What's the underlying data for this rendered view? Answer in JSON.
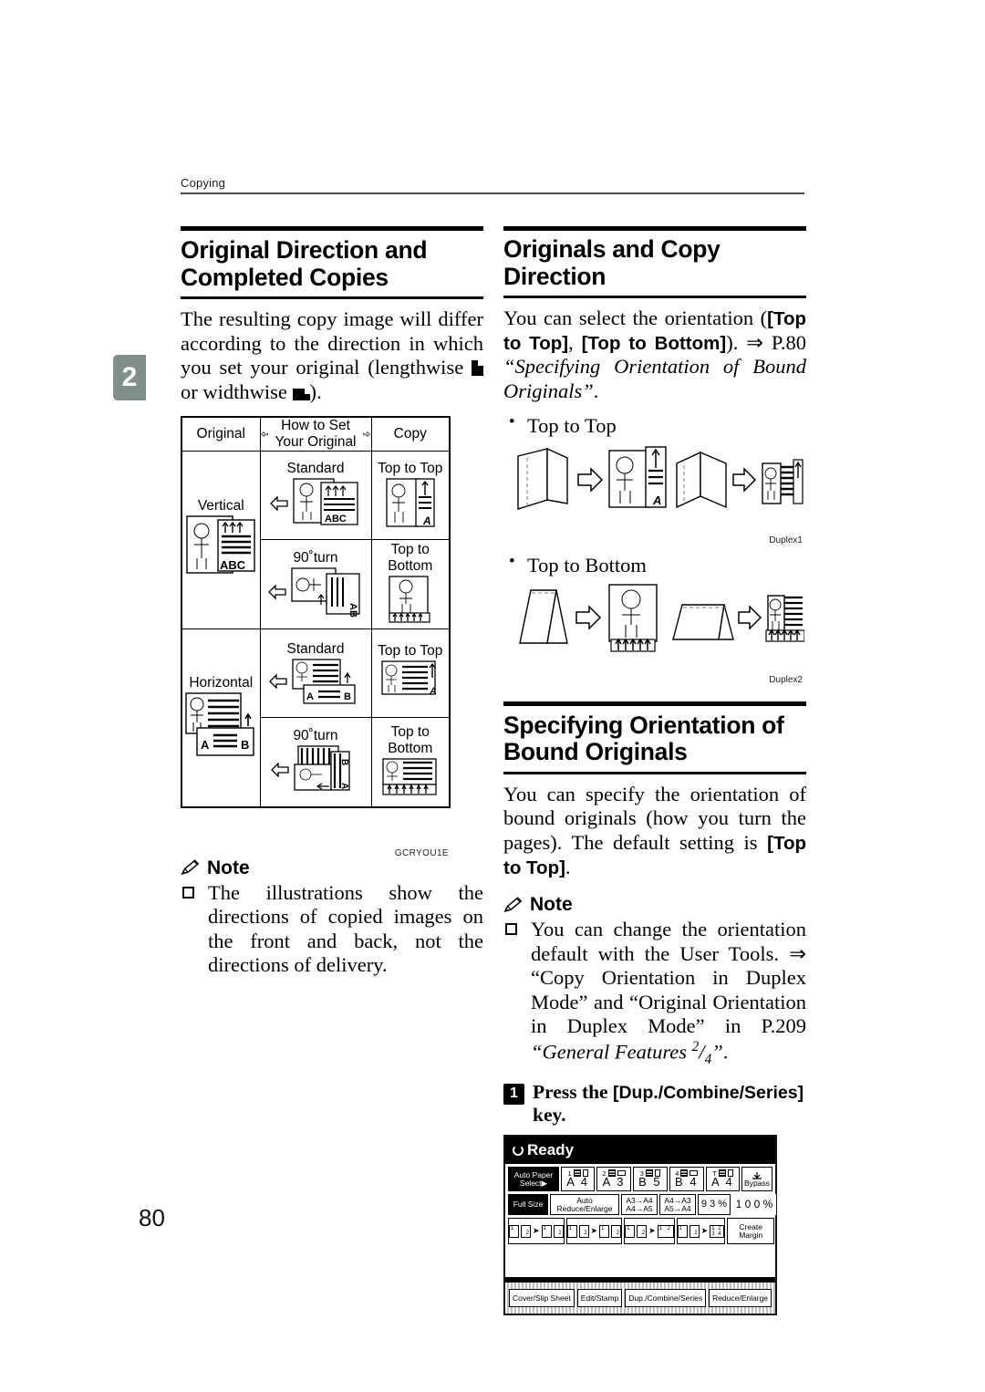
{
  "running_head": "Copying",
  "chapter_tab": "2",
  "folio": "80",
  "left": {
    "section1": {
      "heading": "Original Direction and Completed Copies",
      "body_parts": {
        "p1": "The resulting copy image will differ according to the direction in which you set your original (lengthwise ",
        "p2": " or widthwise ",
        "p3": ")."
      }
    },
    "figure": {
      "id": "GCRYOU1E",
      "headers": [
        "Original",
        "How to Set Your Original",
        "Copy"
      ],
      "rows": [
        {
          "original": "Vertical",
          "set": [
            "Standard",
            "90˚turn"
          ],
          "copy": [
            "Top to Top",
            "Top to Bottom"
          ]
        },
        {
          "original": "Horizontal",
          "set": [
            "Standard",
            "90˚turn"
          ],
          "copy": [
            "Top to Top",
            "Top to Bottom"
          ]
        }
      ],
      "original_doc_label_vertical": "ABC",
      "original_doc_label_horizontal": "A    B"
    },
    "note": {
      "label": "Note",
      "items": [
        "The illustrations show the directions of copied images on the front and back, not the directions of delivery."
      ]
    }
  },
  "right": {
    "section2": {
      "heading": "Originals and Copy Direction",
      "body": {
        "t1": "You can select the orientation (",
        "k1": "[Top to Top]",
        "t2": ", ",
        "k2": "[Top to Bottom]",
        "t3": "). ⇒ P.80 ",
        "i1": "“Specifying Orientation of Bound Originals”",
        "t4": "."
      },
      "bullets": [
        "Top to Top",
        "Top to Bottom"
      ],
      "figure_ids": [
        "Duplex1",
        "Duplex2"
      ]
    },
    "section3": {
      "heading": "Specifying Orientation of Bound Originals",
      "body": {
        "t1": "You can specify the orientation of bound originals (how you turn the pages). The default setting is ",
        "k1": "[Top to Top]",
        "t2": "."
      },
      "note": {
        "label": "Note",
        "items_parts": {
          "t1": "You can change the orientation default with the User Tools. ⇒ “Copy Orientation in Duplex Mode” and “Original Orientation in Duplex Mode” in P.209 ",
          "i1": "“General Features ",
          "sup": "2",
          "slash": "/",
          "sub": "4",
          "i2": "”",
          "t2": "."
        }
      },
      "step": {
        "number": "1",
        "text_before": "Press the ",
        "key": "[Dup./Combine/Series]",
        "text_after": " key."
      }
    }
  },
  "lcd": {
    "status": "Ready",
    "paper_row": {
      "select_button": {
        "line1": "Auto Paper",
        "line2": "Select▶"
      },
      "trays": [
        {
          "num": "1",
          "size": "A 4",
          "orient": "portrait"
        },
        {
          "num": "2",
          "size": "A 3",
          "orient": "landscape"
        },
        {
          "num": "3",
          "size": "B 5",
          "orient": "portrait"
        },
        {
          "num": "4",
          "size": "B 4",
          "orient": "landscape"
        },
        {
          "num": "T",
          "size": "A 4",
          "orient": "portrait"
        }
      ],
      "bypass": "Bypass"
    },
    "ratio_row": {
      "full_size": "Full Size",
      "auto": "Auto Reduce/Enlarge",
      "preset1_l1": "A3→A4",
      "preset1_l2": "A4→A5",
      "preset2_l1": "A4→A3",
      "preset2_l2": "A5→A4",
      "ratio1": "9 3 %",
      "ratio2": "1 0 0 %"
    },
    "duplex_row": {
      "create_margin_l1": "Create",
      "create_margin_l2": "Margin"
    },
    "tabs": [
      "Cover/Slip Sheet",
      "Edit/Stamp",
      "Dup./Combine/Series",
      "Reduce/Enlarge"
    ]
  },
  "colors": {
    "chapter_tab_bg": "#808e8c",
    "rule": "#000000",
    "lcd_bg": "#ffffff"
  }
}
